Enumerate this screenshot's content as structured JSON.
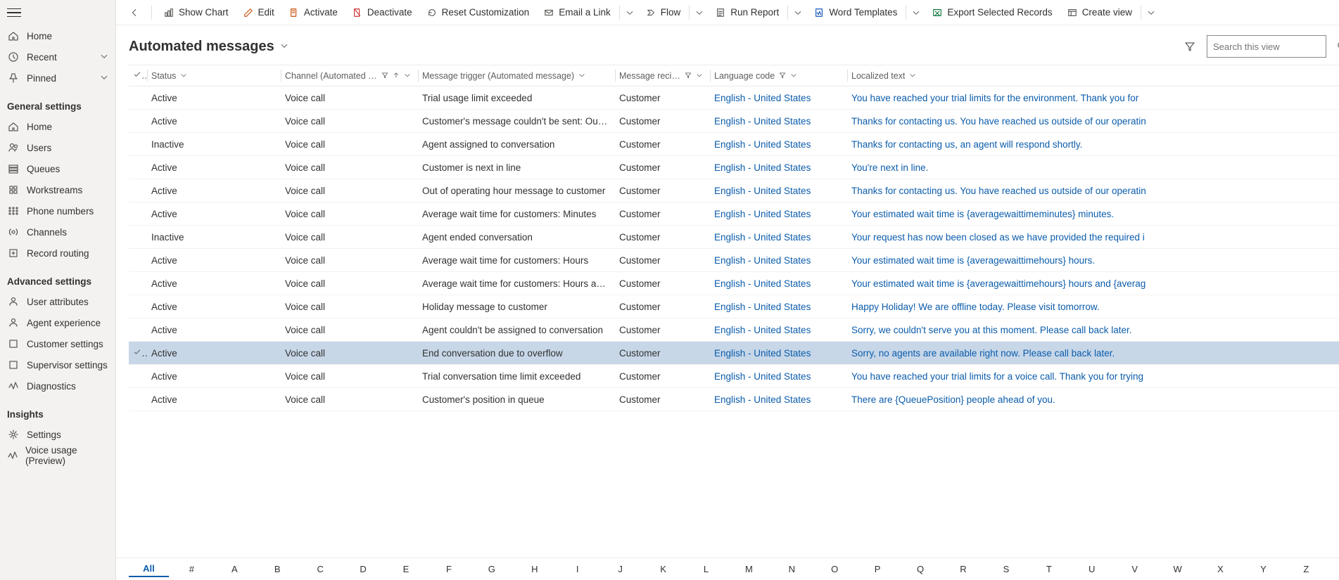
{
  "sidebar": {
    "top_items": [
      {
        "label": "Home"
      },
      {
        "label": "Recent",
        "chev": true
      },
      {
        "label": "Pinned",
        "chev": true
      }
    ],
    "sections": [
      {
        "heading": "General settings",
        "items": [
          {
            "label": "Home"
          },
          {
            "label": "Users"
          },
          {
            "label": "Queues"
          },
          {
            "label": "Workstreams"
          },
          {
            "label": "Phone numbers"
          },
          {
            "label": "Channels"
          },
          {
            "label": "Record routing"
          }
        ]
      },
      {
        "heading": "Advanced settings",
        "items": [
          {
            "label": "User attributes"
          },
          {
            "label": "Agent experience"
          },
          {
            "label": "Customer settings"
          },
          {
            "label": "Supervisor settings"
          },
          {
            "label": "Diagnostics"
          }
        ]
      },
      {
        "heading": "Insights",
        "items": [
          {
            "label": "Settings"
          },
          {
            "label": "Voice usage (Preview)"
          }
        ]
      }
    ]
  },
  "commandbar": {
    "items": [
      {
        "label": "Show Chart",
        "dropdown": false
      },
      {
        "label": "Edit",
        "dropdown": false
      },
      {
        "label": "Activate",
        "dropdown": false
      },
      {
        "label": "Deactivate",
        "dropdown": false
      },
      {
        "label": "Reset Customization",
        "dropdown": false
      },
      {
        "label": "Email a Link",
        "dropdown": true
      },
      {
        "label": "Flow",
        "dropdown": true
      },
      {
        "label": "Run Report",
        "dropdown": true
      },
      {
        "label": "Word Templates",
        "dropdown": true
      },
      {
        "label": "Export Selected Records",
        "dropdown": false
      },
      {
        "label": "Create view",
        "dropdown": true
      }
    ]
  },
  "page": {
    "title": "Automated messages",
    "search_placeholder": "Search this view"
  },
  "columns": {
    "status": "Status",
    "channel": "Channel (Automated message)",
    "trigger": "Message trigger (Automated message)",
    "recipient": "Message recipient (...",
    "lang": "Language code",
    "text": "Localized text"
  },
  "rows": [
    {
      "status": "Active",
      "channel": "Voice call",
      "trigger": "Trial usage limit exceeded",
      "recipient": "Customer",
      "lang": "English - United States",
      "text": "You have reached your trial limits for the environment. Thank you for"
    },
    {
      "status": "Active",
      "channel": "Voice call",
      "trigger": "Customer's message couldn't be sent: Outside ...",
      "recipient": "Customer",
      "lang": "English - United States",
      "text": "Thanks for contacting us. You have reached us outside of our operatin"
    },
    {
      "status": "Inactive",
      "channel": "Voice call",
      "trigger": "Agent assigned to conversation",
      "recipient": "Customer",
      "lang": "English - United States",
      "text": "Thanks for contacting us, an agent will respond shortly."
    },
    {
      "status": "Active",
      "channel": "Voice call",
      "trigger": "Customer is next in line",
      "recipient": "Customer",
      "lang": "English - United States",
      "text": "You're next in line."
    },
    {
      "status": "Active",
      "channel": "Voice call",
      "trigger": "Out of operating hour message to customer",
      "recipient": "Customer",
      "lang": "English - United States",
      "text": "Thanks for contacting us. You have reached us outside of our operatin"
    },
    {
      "status": "Active",
      "channel": "Voice call",
      "trigger": "Average wait time for customers: Minutes",
      "recipient": "Customer",
      "lang": "English - United States",
      "text": "Your estimated wait time is {averagewaittimeminutes} minutes."
    },
    {
      "status": "Inactive",
      "channel": "Voice call",
      "trigger": "Agent ended conversation",
      "recipient": "Customer",
      "lang": "English - United States",
      "text": "Your request has now been closed as we have provided the required i"
    },
    {
      "status": "Active",
      "channel": "Voice call",
      "trigger": "Average wait time for customers: Hours",
      "recipient": "Customer",
      "lang": "English - United States",
      "text": "Your estimated wait time is {averagewaittimehours} hours."
    },
    {
      "status": "Active",
      "channel": "Voice call",
      "trigger": "Average wait time for customers: Hours and mi...",
      "recipient": "Customer",
      "lang": "English - United States",
      "text": "Your estimated wait time is {averagewaittimehours} hours and {averag"
    },
    {
      "status": "Active",
      "channel": "Voice call",
      "trigger": "Holiday message to customer",
      "recipient": "Customer",
      "lang": "English - United States",
      "text": "Happy Holiday! We are offline today. Please visit tomorrow."
    },
    {
      "status": "Active",
      "channel": "Voice call",
      "trigger": "Agent couldn't be assigned to conversation",
      "recipient": "Customer",
      "lang": "English - United States",
      "text": "Sorry, we couldn't serve you at this moment. Please call back later."
    },
    {
      "status": "Active",
      "channel": "Voice call",
      "trigger": "End conversation due to overflow",
      "recipient": "Customer",
      "lang": "English - United States",
      "text": "Sorry, no agents are available right now. Please call back later.",
      "selected": true
    },
    {
      "status": "Active",
      "channel": "Voice call",
      "trigger": "Trial conversation time limit exceeded",
      "recipient": "Customer",
      "lang": "English - United States",
      "text": "You have reached your trial limits for a voice call. Thank you for trying"
    },
    {
      "status": "Active",
      "channel": "Voice call",
      "trigger": "Customer's position in queue",
      "recipient": "Customer",
      "lang": "English - United States",
      "text": "There are {QueuePosition} people ahead of you."
    }
  ],
  "alphabar": [
    "All",
    "#",
    "A",
    "B",
    "C",
    "D",
    "E",
    "F",
    "G",
    "H",
    "I",
    "J",
    "K",
    "L",
    "M",
    "N",
    "O",
    "P",
    "Q",
    "R",
    "S",
    "T",
    "U",
    "V",
    "W",
    "X",
    "Y",
    "Z"
  ]
}
